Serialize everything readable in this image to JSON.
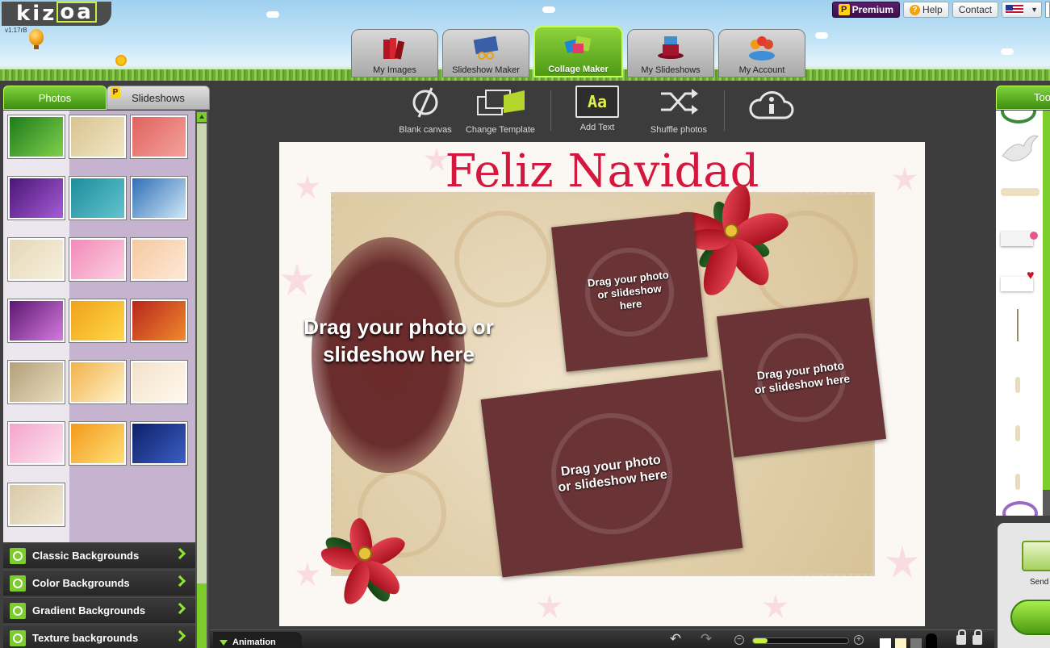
{
  "header": {
    "logo_text": "kizoa",
    "version": "v1.17rB",
    "premium_label": "Premium",
    "premium_letter": "P",
    "help_label": "Help",
    "help_glyph": "?",
    "contact_label": "Contact",
    "language_icon": "us-flag-icon"
  },
  "main_tabs": [
    {
      "label": "My Images",
      "icon": "books-icon"
    },
    {
      "label": "Slideshow Maker",
      "icon": "film-scissors-icon"
    },
    {
      "label": "Collage Maker",
      "icon": "collage-frames-icon",
      "active": true
    },
    {
      "label": "My Slideshows",
      "icon": "magic-hat-icon"
    },
    {
      "label": "My Account",
      "icon": "people-icon"
    }
  ],
  "left_panel": {
    "tabs": [
      {
        "label": "Photos",
        "active": true
      },
      {
        "label": "Slideshows",
        "premium": true,
        "letter": "P"
      }
    ],
    "thumbnails": [
      {
        "name": "green-christmas-tree",
        "colors": [
          "#1f7a1b",
          "#7ed14c"
        ]
      },
      {
        "name": "gold-wreath",
        "colors": [
          "#d9c392",
          "#f2e6c4"
        ]
      },
      {
        "name": "red-frame",
        "colors": [
          "#e0625e",
          "#f4a29c"
        ]
      },
      {
        "name": "purple-christmas-tree",
        "colors": [
          "#4a1674",
          "#a65bd8"
        ]
      },
      {
        "name": "teal-frame",
        "colors": [
          "#1f8c9c",
          "#62c4cf"
        ]
      },
      {
        "name": "blue-sky-mountains",
        "colors": [
          "#2f6fb8",
          "#cfe7f6"
        ]
      },
      {
        "name": "beige-swirls",
        "colors": [
          "#e6d8b8",
          "#f6efdc"
        ]
      },
      {
        "name": "pink-hearts",
        "colors": [
          "#f38ab8",
          "#fbd0e3"
        ]
      },
      {
        "name": "peach-hearts",
        "colors": [
          "#f6c8a0",
          "#fde9d6"
        ]
      },
      {
        "name": "purple-ornaments",
        "colors": [
          "#5c1870",
          "#d47adf"
        ]
      },
      {
        "name": "orange-yellow",
        "colors": [
          "#f0a21a",
          "#ffd84a"
        ]
      },
      {
        "name": "red-orange",
        "colors": [
          "#b8261c",
          "#f08a2c"
        ]
      },
      {
        "name": "garland-door",
        "colors": [
          "#b4a07a",
          "#e9dcbc"
        ]
      },
      {
        "name": "gold-gifts",
        "colors": [
          "#f2b24a",
          "#fff2cc"
        ]
      },
      {
        "name": "cream-ornaments",
        "colors": [
          "#f3e2c8",
          "#fff8ef"
        ]
      },
      {
        "name": "pink-gifts",
        "colors": [
          "#f4a4cc",
          "#fde4f0"
        ]
      },
      {
        "name": "orange-waves",
        "colors": [
          "#f39a1a",
          "#ffe07a"
        ]
      },
      {
        "name": "night-fireworks",
        "colors": [
          "#0f1f66",
          "#3b5fc6"
        ]
      },
      {
        "name": "winter-tree-sketch",
        "colors": [
          "#d8c9a8",
          "#f2e8d2"
        ]
      }
    ],
    "categories": [
      {
        "label": "Classic Backgrounds"
      },
      {
        "label": "Color Backgrounds"
      },
      {
        "label": "Gradient Backgrounds"
      },
      {
        "label": "Texture backgrounds"
      }
    ]
  },
  "toolbar": {
    "blank_canvas": "Blank canvas",
    "change_template": "Change Template",
    "add_text": "Add Text",
    "add_text_glyph": "Aa",
    "shuffle_photos": "Shuffle photos"
  },
  "collage": {
    "title": "Feliz Navidad",
    "slot_text": "Drag your photo or slideshow here",
    "slot_color": "#6a3436",
    "title_color": "#d5173f"
  },
  "right_panel": {
    "tools_label": "Tools",
    "send_label": "Send"
  },
  "bottom_bar": {
    "animation_label": "Animation",
    "zoom_fraction": 0.15
  }
}
